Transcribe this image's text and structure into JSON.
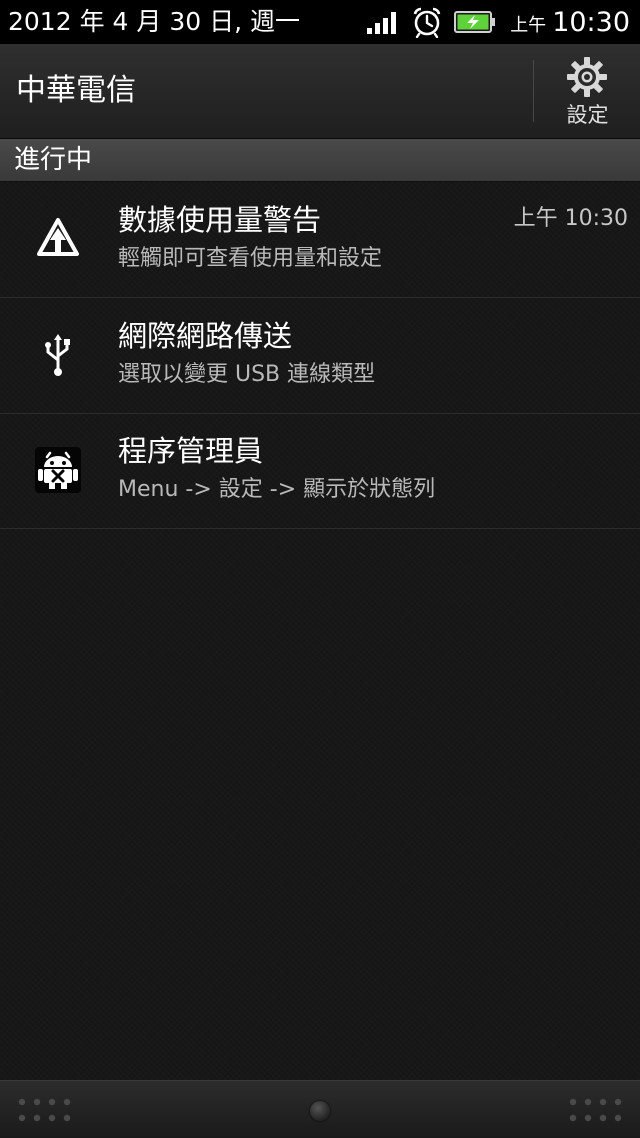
{
  "status_bar": {
    "date": "2012 年 4 月 30 日, 週一",
    "ampm": "上午",
    "time": "10:30",
    "icons": [
      "signal-icon",
      "alarm-icon",
      "battery-charging-icon"
    ]
  },
  "header": {
    "carrier": "中華電信",
    "settings_label": "設定",
    "settings_icon": "gear-icon"
  },
  "section": {
    "title": "進行中"
  },
  "notifications": [
    {
      "icon": "data-usage-warning-icon",
      "title": "數據使用量警告",
      "subtitle": "輕觸即可查看使用量和設定",
      "time": "上午 10:30"
    },
    {
      "icon": "usb-icon",
      "title": "網際網路傳送",
      "subtitle": "選取以變更 USB 連線類型",
      "time": ""
    },
    {
      "icon": "task-manager-icon",
      "title": "程序管理員",
      "subtitle": "Menu -> 設定 -> 顯示於狀態列",
      "time": ""
    }
  ],
  "colors": {
    "background": "#171717",
    "status_bar": "#000000",
    "battery_green": "#5fd13a",
    "subtitle_text": "#b9b9b9"
  }
}
